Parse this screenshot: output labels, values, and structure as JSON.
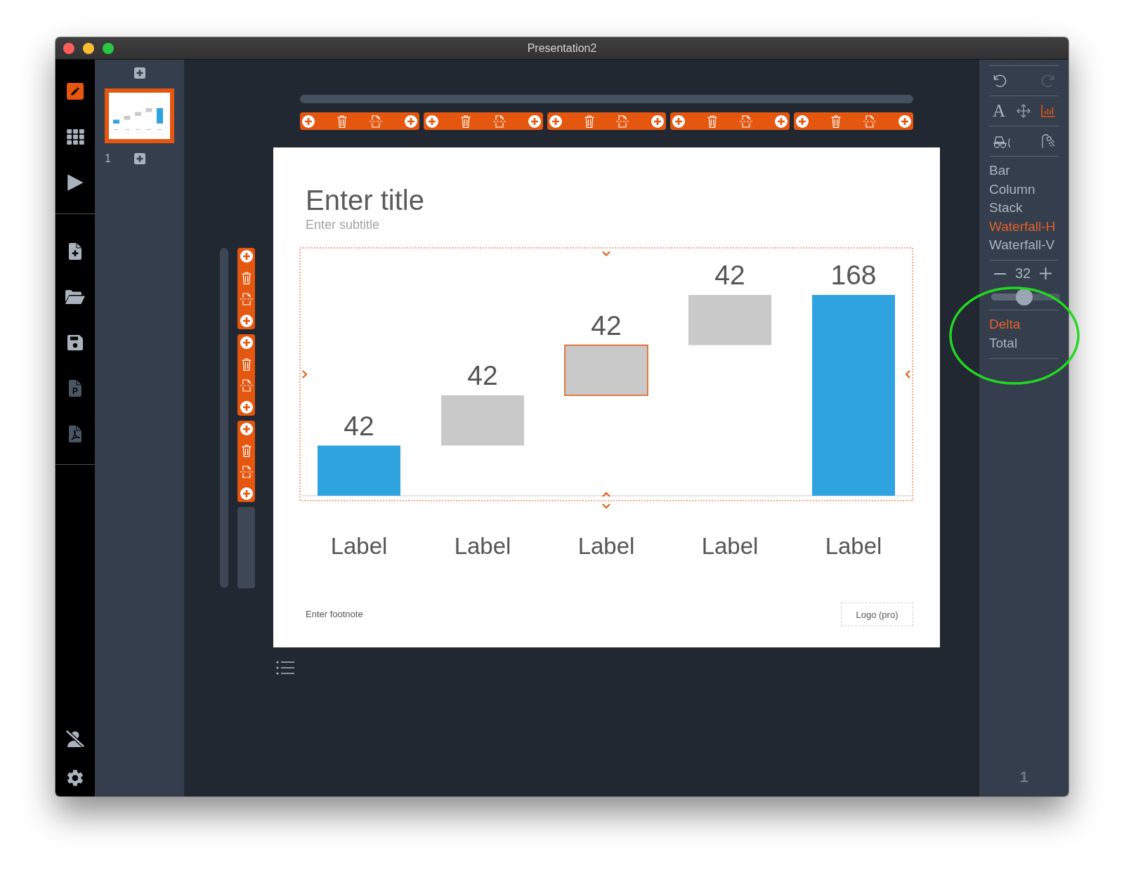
{
  "window": {
    "title": "Presentation2"
  },
  "nav": [
    {
      "kind": "edit",
      "selected": true
    },
    {
      "kind": "grid",
      "selected": false
    },
    {
      "kind": "play",
      "selected": false
    }
  ],
  "file_actions": [
    {
      "kind": "new",
      "disabled": false
    },
    {
      "kind": "open",
      "disabled": false
    },
    {
      "kind": "save",
      "disabled": false
    },
    {
      "kind": "document",
      "glyph": "P",
      "disabled": true
    },
    {
      "kind": "pdf",
      "disabled": true
    }
  ],
  "account_actions": [
    {
      "kind": "user-off"
    },
    {
      "kind": "settings"
    }
  ],
  "slides": [
    {
      "number": "1",
      "selected": true
    }
  ],
  "slide": {
    "title": "Enter title",
    "subtitle": "Enter subtitle",
    "footnote": "Enter footnote",
    "logo": "Logo (pro)"
  },
  "chart": {
    "bars": [
      {
        "kind": "total",
        "value": "42",
        "label": "Label",
        "color": "#2fa3e0",
        "selected": false
      },
      {
        "kind": "delta",
        "value": "42",
        "label": "Label",
        "color": "#c9c9c9",
        "selected": false
      },
      {
        "kind": "delta",
        "value": "42",
        "label": "Label",
        "color": "#c9c9c9",
        "selected": true
      },
      {
        "kind": "delta",
        "value": "42",
        "label": "Label",
        "color": "#c9c9c9",
        "selected": false
      },
      {
        "kind": "total",
        "value": "168",
        "label": "Label",
        "color": "#2fa3e0",
        "selected": false
      }
    ]
  },
  "panel": {
    "history": [
      {
        "kind": "undo",
        "disabled": false
      },
      {
        "kind": "redo",
        "disabled": true
      }
    ],
    "tools": [
      {
        "kind": "text",
        "glyph": "A",
        "selected": false
      },
      {
        "kind": "move",
        "selected": false
      },
      {
        "kind": "chart",
        "selected": true
      }
    ],
    "effects": [
      {
        "kind": "vehicle"
      },
      {
        "kind": "shower"
      }
    ],
    "chart_types": [
      {
        "label": "Bar",
        "selected": false
      },
      {
        "label": "Column",
        "selected": false
      },
      {
        "label": "Stack",
        "selected": false
      },
      {
        "label": "Waterfall-H",
        "selected": true
      },
      {
        "label": "Waterfall-V",
        "selected": false
      }
    ],
    "font_size": {
      "value": "32",
      "level": 0.48
    },
    "series_kinds": [
      {
        "label": "Delta",
        "selected": true
      },
      {
        "label": "Total",
        "selected": false
      }
    ],
    "page_number": "1"
  }
}
